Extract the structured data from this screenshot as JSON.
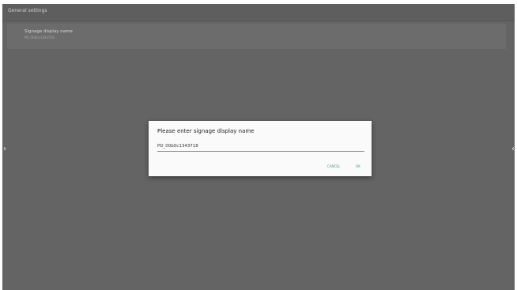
{
  "header": {
    "title": "General settings"
  },
  "setting": {
    "title": "Signage display name",
    "value": "PD_00b0c1343718"
  },
  "nav": {
    "left_glyph": "›",
    "right_glyph": "‹"
  },
  "dialog": {
    "title": "Please enter signage display name",
    "input_value": "PD_00b0c1343718",
    "cancel_label": "CANCEL",
    "ok_label": "OK"
  },
  "colors": {
    "screen_bg": "#646464",
    "dialog_bg": "#fafafa",
    "accent": "#4a9a8a"
  }
}
